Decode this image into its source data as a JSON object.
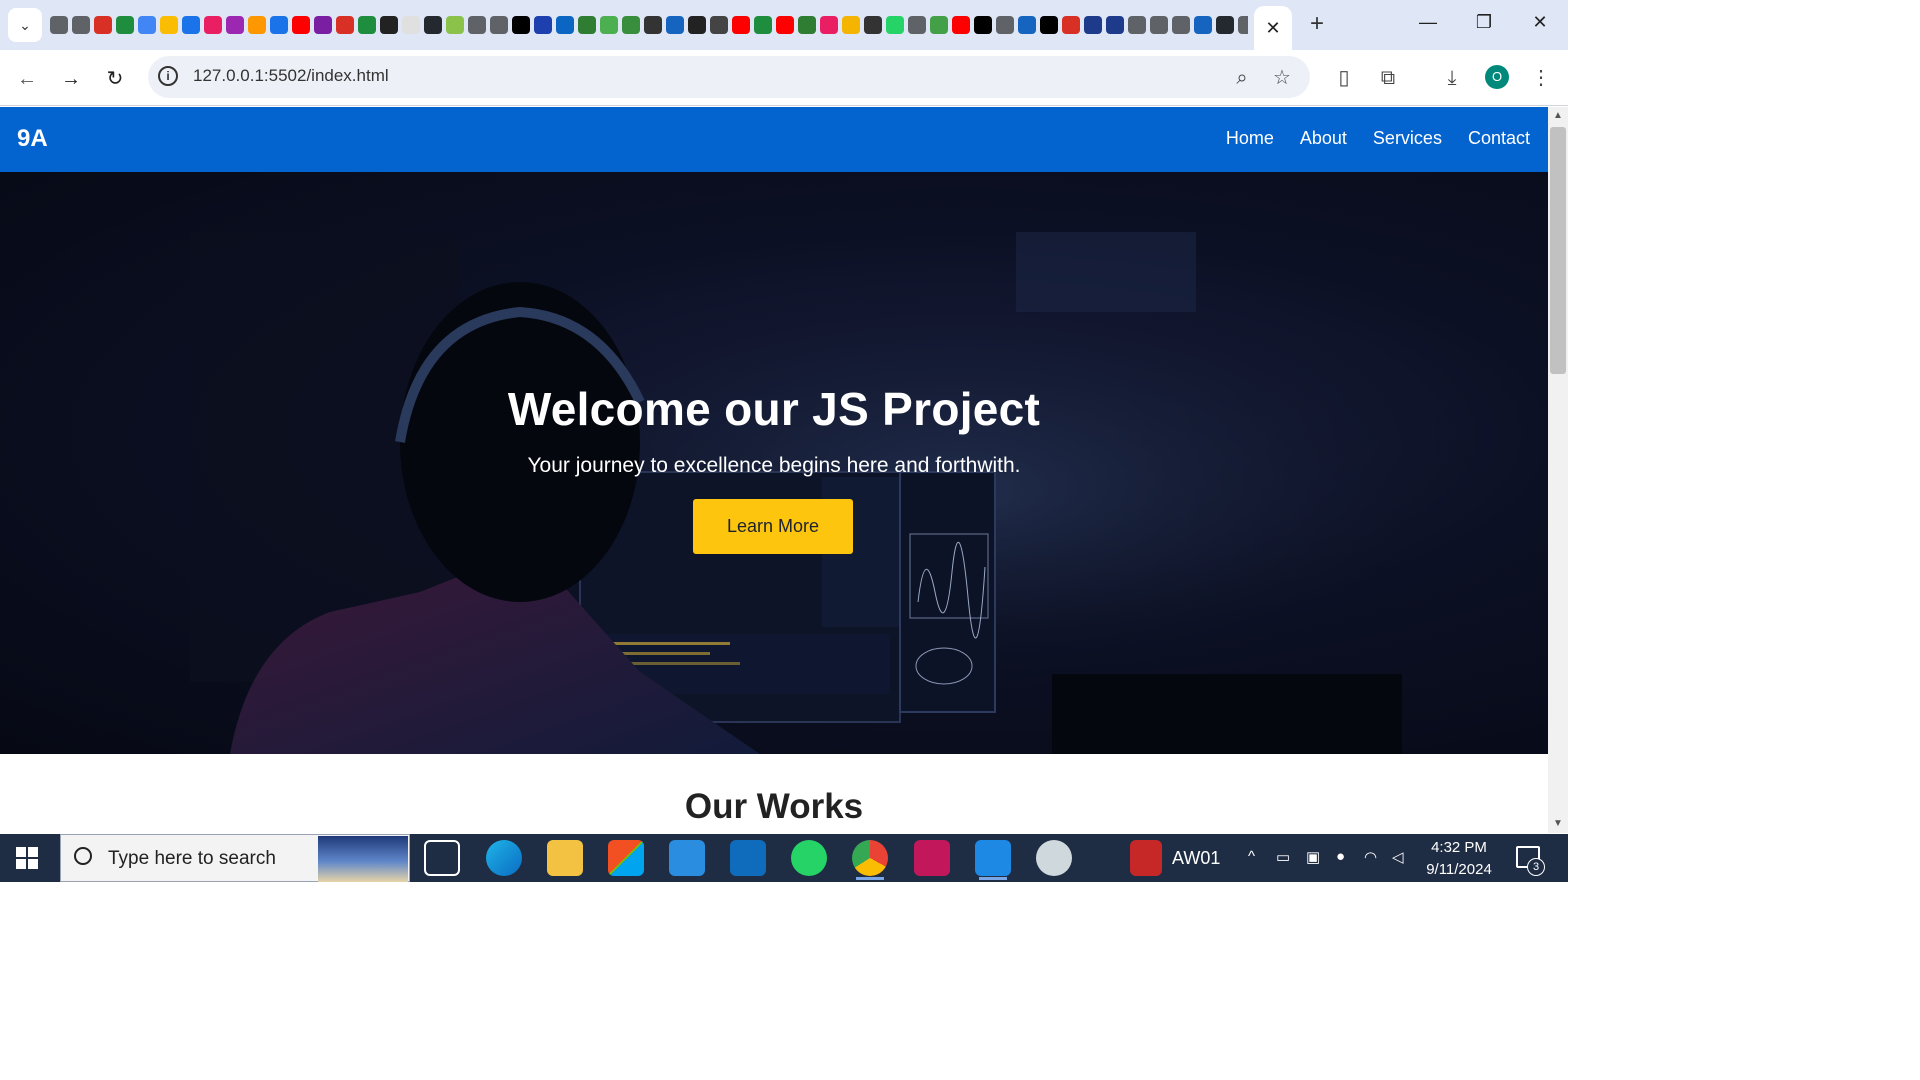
{
  "browser": {
    "url": "127.0.0.1:5502/index.html",
    "tab_close_glyph": "✕",
    "new_tab_glyph": "+",
    "profile_initial": "O",
    "pinned_favicon_colors": [
      "#5f6368",
      "#5f6368",
      "#d93025",
      "#1e8e3e",
      "#4285f4",
      "#fbbc04",
      "#1a73e8",
      "#e91e63",
      "#9c27b0",
      "#ff9800",
      "#1a73e8",
      "#ff0000",
      "#7b1fa2",
      "#d93025",
      "#1e8e3e",
      "#222222",
      "#e0e0e0",
      "#24292f",
      "#8bc34a",
      "#5f6368",
      "#5f6368",
      "#000000",
      "#1e40af",
      "#0a66c2",
      "#2e7d32",
      "#4caf50",
      "#388e3c",
      "#333333",
      "#1565c0",
      "#222222",
      "#444444",
      "#ff0000",
      "#1e8e3e",
      "#ff0000",
      "#2e7d32",
      "#e91e63",
      "#f4b400",
      "#333333",
      "#25d366",
      "#5f6368",
      "#43a047",
      "#ff0000",
      "#000000",
      "#5f6368",
      "#1565c0",
      "#000000",
      "#d93025",
      "#1e3a8a",
      "#1e3a8a",
      "#5f6368",
      "#5f6368",
      "#5f6368",
      "#1565c0",
      "#24292f",
      "#5f6368"
    ]
  },
  "site": {
    "logo": "9A",
    "nav": [
      "Home",
      "About",
      "Services",
      "Contact"
    ],
    "hero": {
      "title": "Welcome our JS Project",
      "subtitle": "Your journey to excellence begins here and forthwith.",
      "cta": "Learn More"
    },
    "section_title": "Our Works",
    "colors": {
      "nav_bg": "#0363cf",
      "cta_bg": "#fdc50d"
    }
  },
  "taskbar": {
    "search_placeholder": "Type here to search",
    "app_label": "AW01",
    "time": "4:32 PM",
    "date": "9/11/2024",
    "notification_count": "3"
  }
}
